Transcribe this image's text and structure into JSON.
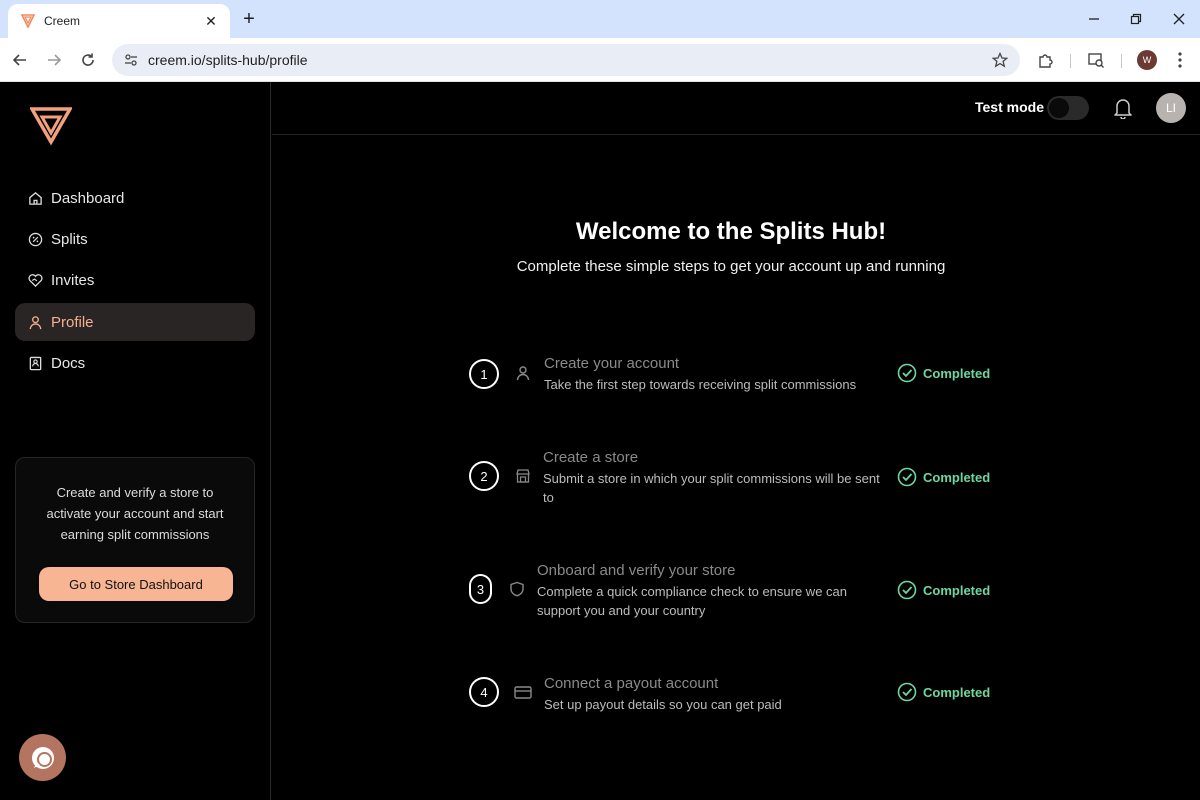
{
  "browser": {
    "tab_title": "Creem",
    "tab_close": "✕",
    "new_tab": "+",
    "url": "creem.io/splits-hub/profile",
    "profile_initial": "W"
  },
  "sidebar": {
    "items": [
      {
        "label": "Dashboard",
        "icon": "home-icon"
      },
      {
        "label": "Splits",
        "icon": "percent-icon"
      },
      {
        "label": "Invites",
        "icon": "handshake-heart-icon"
      },
      {
        "label": "Profile",
        "icon": "user-icon",
        "active": true
      },
      {
        "label": "Docs",
        "icon": "book-icon"
      }
    ],
    "promo": {
      "text": "Create and verify a store to activate your account and start earning split commissions",
      "button": "Go to Store Dashboard"
    }
  },
  "header": {
    "test_mode_label": "Test mode",
    "test_mode_on": false,
    "avatar_initials": "LI"
  },
  "main": {
    "title": "Welcome to the Splits Hub!",
    "subtitle": "Complete these simple steps to get your account up and running",
    "steps": [
      {
        "number": "1",
        "title": "Create your account",
        "description": "Take the first step towards receiving split commissions",
        "status": "Completed",
        "icon": "user-icon"
      },
      {
        "number": "2",
        "title": "Create a store",
        "description": "Submit a store in which your split commissions will be sent to",
        "status": "Completed",
        "icon": "store-icon"
      },
      {
        "number": "3",
        "title": "Onboard and verify your store",
        "description": "Complete a quick compliance check to ensure we can support you and your country",
        "status": "Completed",
        "icon": "shield-icon"
      },
      {
        "number": "4",
        "title": "Connect a payout account",
        "description": "Set up payout details so you can get paid",
        "status": "Completed",
        "icon": "credit-card-icon"
      }
    ]
  },
  "colors": {
    "accent": "#f7b594",
    "completed": "#6fd6a0",
    "background": "#000000"
  }
}
